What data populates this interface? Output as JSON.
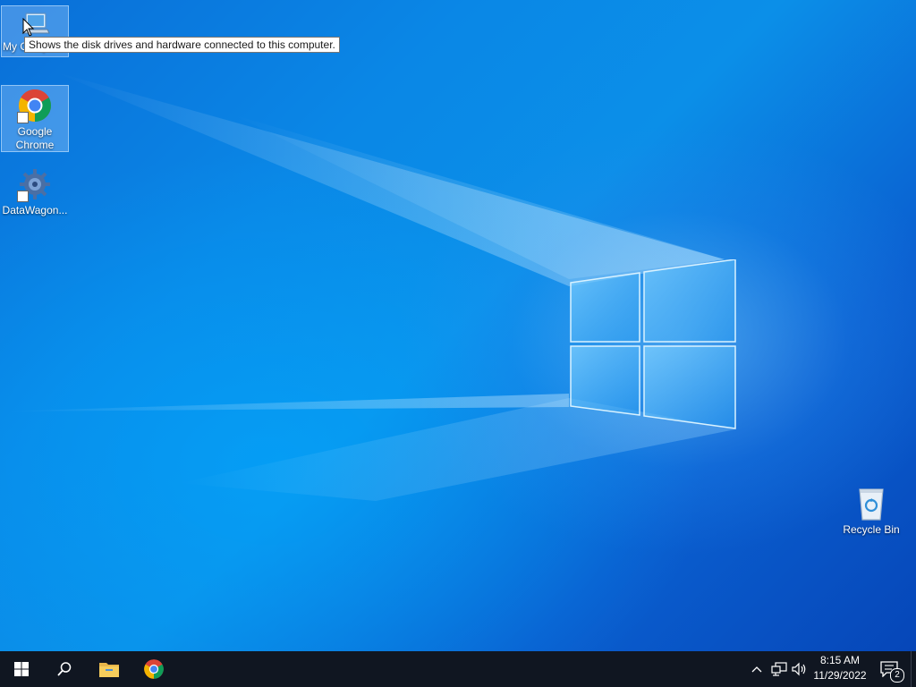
{
  "desktop": {
    "icons": [
      {
        "label": "My Computer"
      },
      {
        "label": "Google\nChrome"
      },
      {
        "label": "DataWagon..."
      },
      {
        "label": "Recycle Bin"
      }
    ],
    "tooltip": "Shows the disk drives and hardware connected to this computer."
  },
  "taskbar": {
    "start_icon": "windows-start-icon",
    "search_icon": "search-icon",
    "pinned": [
      {
        "name": "file-explorer-icon"
      },
      {
        "name": "chrome-icon"
      }
    ],
    "tray": {
      "overflow_icon": "chevron-up-icon",
      "network_icon": "network-icon",
      "volume_icon": "volume-icon"
    },
    "clock": {
      "time": "8:15 AM",
      "date": "11/29/2022"
    },
    "notifications": {
      "icon": "action-center-icon",
      "count": "2"
    }
  },
  "colors": {
    "taskbar": "#101621",
    "wallpaper_accent": "#0a87e6"
  }
}
